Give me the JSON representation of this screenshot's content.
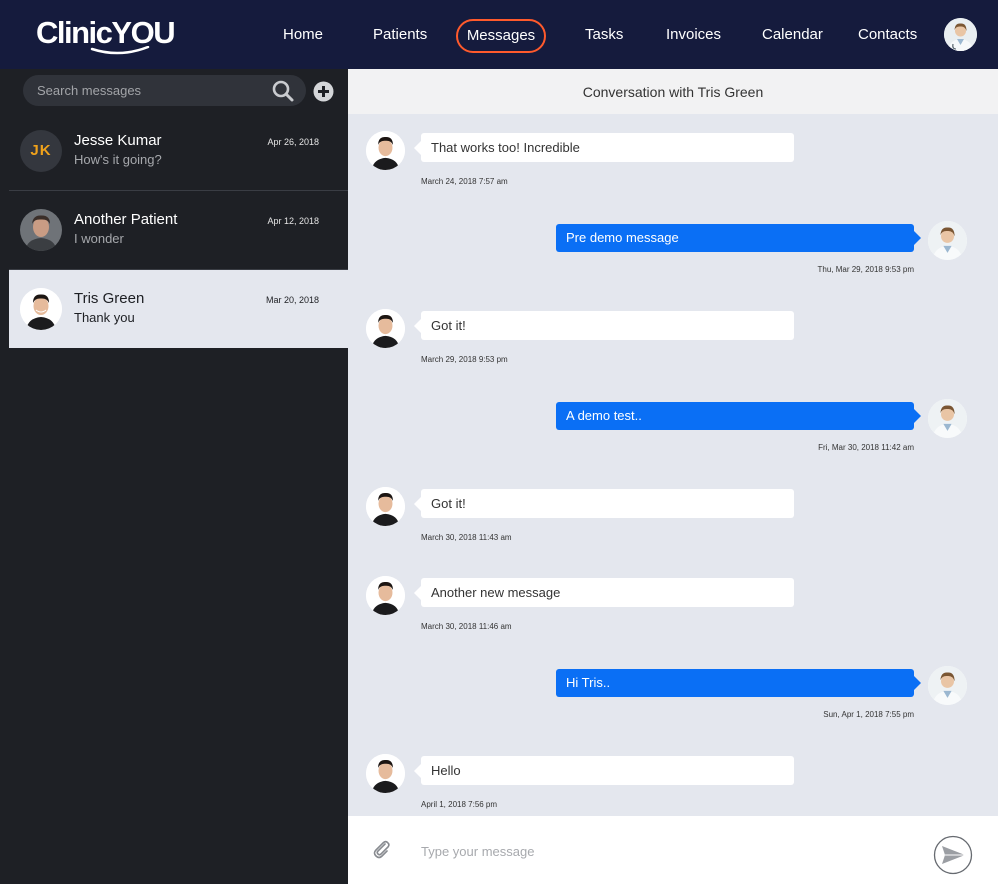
{
  "app": {
    "logo_text": "ClinicYOU"
  },
  "nav": {
    "items": [
      "Home",
      "Patients",
      "Messages",
      "Tasks",
      "Invoices",
      "Calendar",
      "Contacts"
    ],
    "active": "Messages"
  },
  "sidebar": {
    "search_placeholder": "Search messages",
    "conversations": [
      {
        "initials": "JK",
        "name": "Jesse Kumar",
        "preview": "How's it going?",
        "date": "Apr 26, 2018"
      },
      {
        "name": "Another Patient",
        "preview": "I wonder",
        "date": "Apr 12, 2018"
      },
      {
        "name": "Tris Green",
        "preview": "Thank you",
        "date": "Mar 20, 2018",
        "selected": true
      }
    ]
  },
  "conversation": {
    "title": "Conversation with Tris Green",
    "messages": [
      {
        "direction": "in",
        "text": "That works too! Incredible",
        "time": "March 24, 2018 7:57 am"
      },
      {
        "direction": "out",
        "text": "Pre demo message",
        "time": "Thu, Mar 29, 2018 9:53 pm"
      },
      {
        "direction": "in",
        "text": "Got it!",
        "time": "March 29, 2018 9:53 pm"
      },
      {
        "direction": "out",
        "text": "A demo test..",
        "time": "Fri, Mar 30, 2018 11:42 am"
      },
      {
        "direction": "in",
        "text": "Got it!",
        "time": "March 30, 2018 11:43 am"
      },
      {
        "direction": "in",
        "text": "Another new message",
        "time": "March 30, 2018 11:46 am"
      },
      {
        "direction": "out",
        "text": "Hi Tris..",
        "time": "Sun, Apr 1, 2018 7:55 pm"
      },
      {
        "direction": "in",
        "text": "Hello",
        "time": "April 1, 2018 7:56 pm"
      }
    ]
  },
  "composer": {
    "placeholder": "Type your message"
  },
  "colors": {
    "nav_bg": "#151b3d",
    "active_nav_border": "#ff5a2c",
    "sidebar_bg": "#1e2025",
    "chat_bg": "#e4e7ee",
    "outgoing_bubble": "#0a6ff5",
    "initials_color": "#f0a21b"
  },
  "icons": [
    "search-icon",
    "plus-circle-icon",
    "paperclip-icon",
    "send-icon"
  ]
}
